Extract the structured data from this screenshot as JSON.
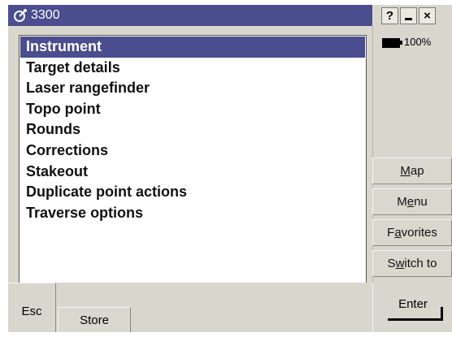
{
  "title_bar": {
    "title": "3300",
    "app_icon": "satellite-dish-icon",
    "help_label": "?",
    "minimize_icon": "minimize-icon",
    "close_label": "×"
  },
  "menu_list": {
    "items": [
      {
        "label": "Instrument",
        "selected": true
      },
      {
        "label": "Target details",
        "selected": false
      },
      {
        "label": "Laser rangefinder",
        "selected": false
      },
      {
        "label": "Topo point",
        "selected": false
      },
      {
        "label": "Rounds",
        "selected": false
      },
      {
        "label": "Corrections",
        "selected": false
      },
      {
        "label": "Stakeout",
        "selected": false
      },
      {
        "label": "Duplicate point actions",
        "selected": false
      },
      {
        "label": "Traverse options",
        "selected": false
      }
    ]
  },
  "status": {
    "battery_icon": "battery-icon",
    "battery_level": "100%"
  },
  "side_buttons": {
    "map": {
      "label": "Map",
      "hotkey": "M"
    },
    "menu": {
      "label": "Menu",
      "hotkey": "e"
    },
    "favorites": {
      "label": "Favorites",
      "hotkey": "a"
    },
    "switch_to": {
      "label": "Switch to",
      "hotkey": "w"
    }
  },
  "bottom_buttons": {
    "esc": "Esc",
    "store": "Store",
    "enter": "Enter"
  },
  "colors": {
    "title_bar": "#4a4d8e",
    "selection": "#4a4d8e",
    "panel": "#d9d6cd"
  }
}
